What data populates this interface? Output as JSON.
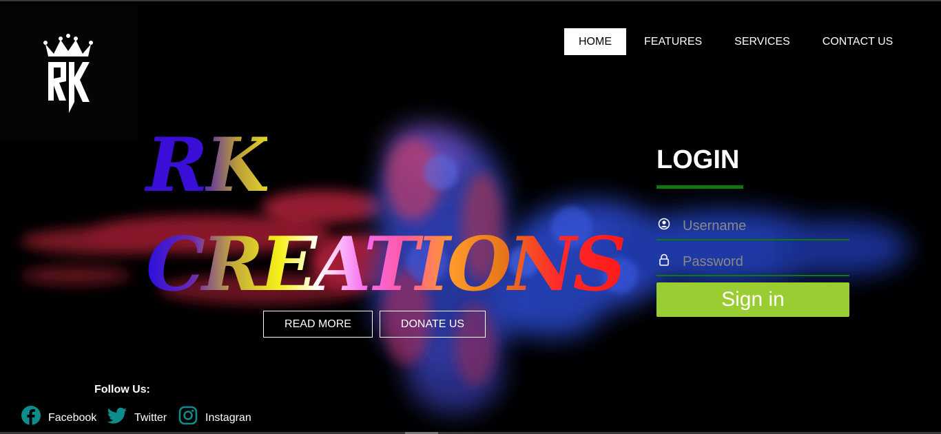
{
  "nav": {
    "items": [
      {
        "label": "HOME",
        "active": true
      },
      {
        "label": "FEATURES",
        "active": false
      },
      {
        "label": "SERVICES",
        "active": false
      },
      {
        "label": "CONTACT US",
        "active": false
      }
    ]
  },
  "logo": {
    "text": "RK"
  },
  "hero": {
    "title_line1": "RK",
    "title_line2": "CREATIONS",
    "read_more_label": "READ MORE",
    "donate_label": "DONATE US"
  },
  "login": {
    "title": "LOGIN",
    "username_placeholder": "Username",
    "password_placeholder": "Password",
    "signin_label": "Sign in",
    "accent_color": "#0b7a0b",
    "button_color": "#9acd32"
  },
  "social": {
    "title": "Follow Us:",
    "facebook_label": "Facebook",
    "twitter_label": "Twitter",
    "instagram_label": "Instagran",
    "icon_color": "#0e8b8b"
  }
}
